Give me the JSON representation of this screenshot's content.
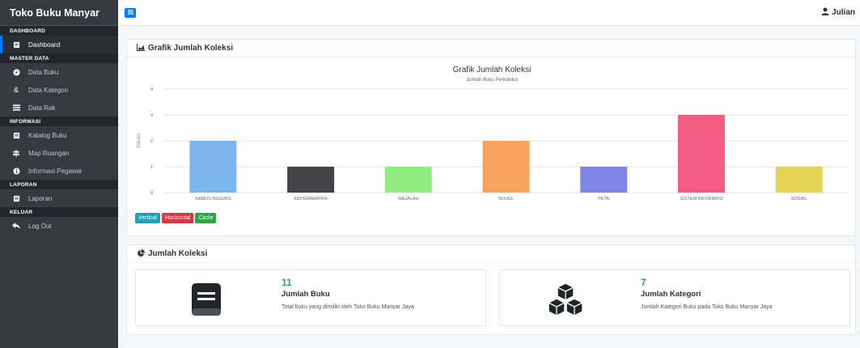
{
  "sidebar": {
    "brand": "Toko Buku Manyar",
    "sections": [
      {
        "header": "DASHBOARD",
        "items": [
          {
            "label": "Dashboard",
            "icon": "book-icon",
            "active": true
          }
        ]
      },
      {
        "header": "MASTER DATA",
        "items": [
          {
            "label": "Data Buku",
            "icon": "compass-icon"
          },
          {
            "label": "Data Kategori",
            "icon": "ampersand-icon"
          },
          {
            "label": "Data Rak",
            "icon": "bars-icon"
          }
        ]
      },
      {
        "header": "INFORMASI",
        "items": [
          {
            "label": "Katalog Buku",
            "icon": "book-icon"
          },
          {
            "label": "Map Ruangan",
            "icon": "map-signs-icon"
          },
          {
            "label": "Informasi Pegawai",
            "icon": "info-circle-icon"
          }
        ]
      },
      {
        "header": "LAPORAN",
        "items": [
          {
            "label": "Laporan",
            "icon": "book-icon"
          }
        ]
      },
      {
        "header": "KELUAR",
        "items": [
          {
            "label": "Log Out",
            "icon": "reply-icon"
          }
        ]
      }
    ]
  },
  "navbar": {
    "user": "Julian"
  },
  "chart_card": {
    "title": "Grafik Jumlah Koleksi",
    "buttons": {
      "vertical": "Vertical",
      "horizontal": "Horizontal",
      "circle": "Circle"
    }
  },
  "chart_data": {
    "type": "bar",
    "title": "Grafik Jumlah Koleksi",
    "subtitle": "Jumlah Buku Perkoleksi",
    "ylabel": "Values",
    "xlabel": "",
    "ylim": [
      0,
      4
    ],
    "yticks": [
      0,
      1,
      2,
      3,
      4
    ],
    "grid": true,
    "categories": [
      "KAMUS INGGRIS",
      "KEPERAWATAN",
      "MAJALAH",
      "NOVEL",
      "PETA",
      "SISTEM INFORMASI",
      "SOSIAL"
    ],
    "values": [
      2,
      1,
      1,
      2,
      1,
      3,
      1
    ],
    "colors": [
      "#7cb5ec",
      "#434348",
      "#90ed7d",
      "#f7a35c",
      "#8085e9",
      "#f15c80",
      "#e4d354"
    ]
  },
  "summary_card": {
    "title": "Jumlah Koleksi",
    "stats": [
      {
        "number": "11",
        "title": "Jumlah Buku",
        "desc": "Total buku yang dimiliki oleh Toko Buku Manyar Jaya",
        "icon": "book-icon"
      },
      {
        "number": "7",
        "title": "Jumlah Kategori",
        "desc": "Jumlah Kategori Buku pada Toko Buku Manyar Jaya",
        "icon": "cubes-icon"
      }
    ]
  },
  "colors": {
    "sidebar": "#343a40",
    "accent": "#007bff",
    "stat_number": "#28a745"
  }
}
